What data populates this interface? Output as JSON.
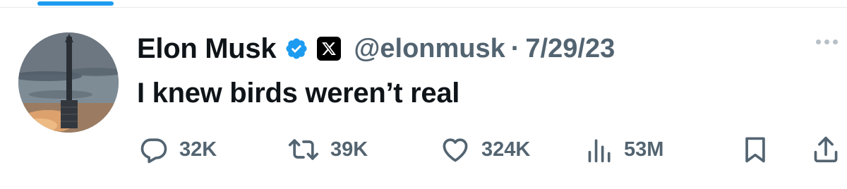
{
  "tweet": {
    "author_name": "Elon Musk",
    "handle": "@elonmusk",
    "separator": "·",
    "date": "7/29/23",
    "text": "I knew birds weren’t real"
  },
  "badges": {
    "verified_icon": "verified-check-icon",
    "affiliate_icon": "x-logo-icon"
  },
  "actions": {
    "replies": "32K",
    "reposts": "39K",
    "likes": "324K",
    "views": "53M"
  },
  "icons": [
    "reply-icon",
    "repost-icon",
    "like-icon",
    "views-icon",
    "bookmark-icon",
    "share-icon",
    "more-icon"
  ],
  "colors": {
    "text": "#0f1419",
    "secondary": "#536471",
    "accent": "#1d9bf0"
  }
}
